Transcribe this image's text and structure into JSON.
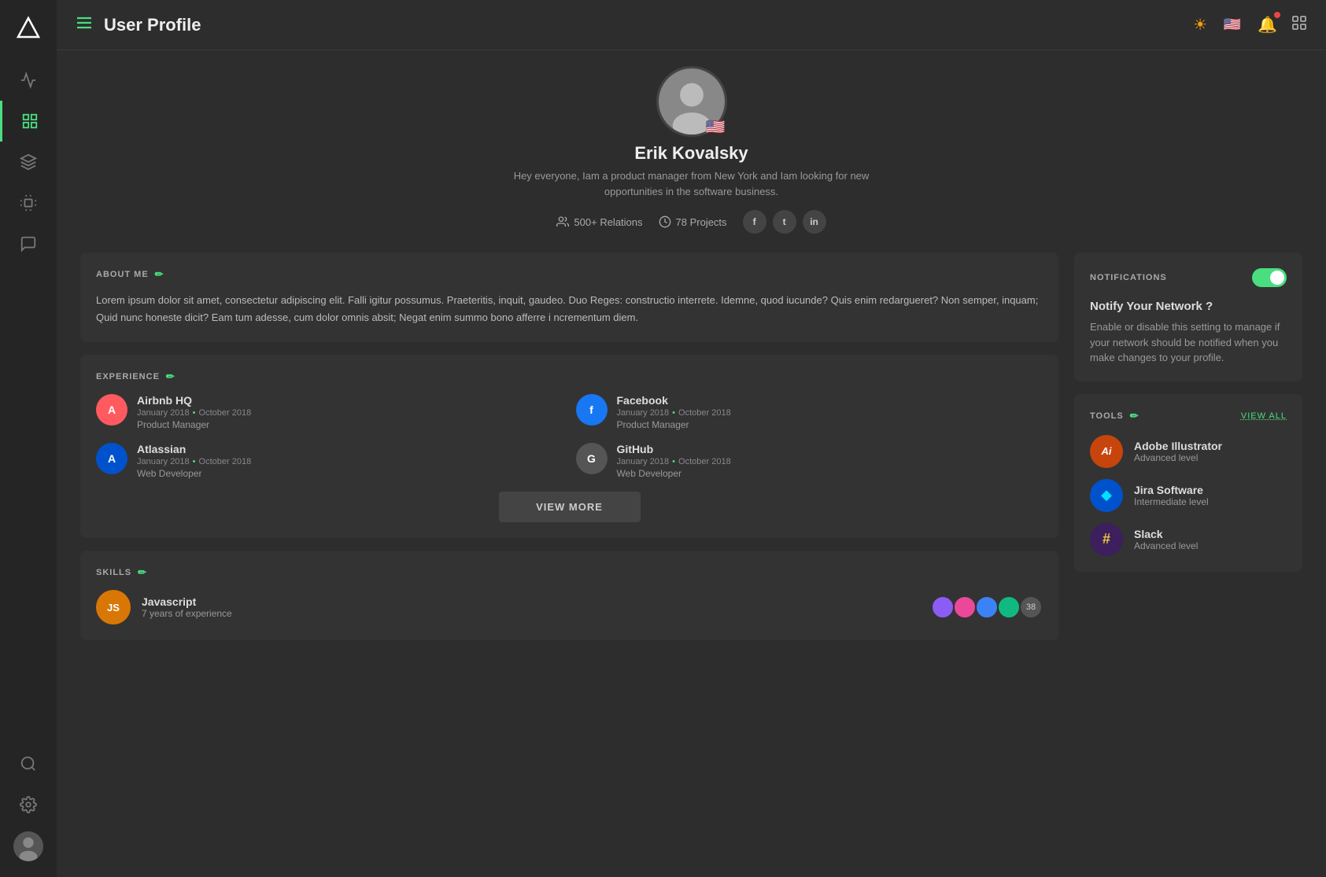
{
  "app": {
    "logo": "triangle",
    "title": "User Profile"
  },
  "sidebar": {
    "items": [
      {
        "id": "activity",
        "icon": "activity"
      },
      {
        "id": "grid",
        "icon": "grid",
        "active": true
      },
      {
        "id": "cube",
        "icon": "cube"
      },
      {
        "id": "chip",
        "icon": "chip"
      },
      {
        "id": "chat",
        "icon": "chat"
      },
      {
        "id": "search",
        "icon": "search"
      },
      {
        "id": "settings",
        "icon": "settings"
      }
    ]
  },
  "header": {
    "title": "User Profile",
    "menu_icon": "☰"
  },
  "profile": {
    "name": "Erik Kovalsky",
    "bio": "Hey everyone,  Iam a product manager from New York and Iam looking for new opportunities in the software business.",
    "flag": "🇺🇸",
    "relations": "500+ Relations",
    "projects": "78 Projects"
  },
  "about": {
    "section_title": "ABOUT ME",
    "text": "Lorem ipsum dolor sit amet, consectetur adipiscing elit. Falli igitur possumus. Praeteritis, inquit, gaudeo. Duo Reges: constructio interrete. Idemne, quod iucunde? Quis enim redargueret? Non semper, inquam; Quid nunc honeste dicit? Eam tum adesse, cum dolor omnis absit; Negat enim summo bono afferre i ncrementum diem."
  },
  "experience": {
    "section_title": "EXPERIENCE",
    "items": [
      {
        "company": "Airbnb HQ",
        "date_start": "January 2018",
        "date_end": "October 2018",
        "role": "Product Manager",
        "logo_text": "A",
        "logo_color": "#ff5a5f"
      },
      {
        "company": "Facebook",
        "date_start": "January 2018",
        "date_end": "October 2018",
        "role": "Product Manager",
        "logo_text": "f",
        "logo_color": "#1877f2"
      },
      {
        "company": "Atlassian",
        "date_start": "January 2018",
        "date_end": "October 2018",
        "role": "Web Developer",
        "logo_text": "A",
        "logo_color": "#0052cc"
      },
      {
        "company": "GitHub",
        "date_start": "January 2018",
        "date_end": "October 2018",
        "role": "Web Developer",
        "logo_text": "G",
        "logo_color": "#555"
      }
    ],
    "view_more_label": "VIEW MORE"
  },
  "skills": {
    "section_title": "SKILLS",
    "items": [
      {
        "name": "Javascript",
        "badge": "JS",
        "badge_color": "#d97706",
        "experience": "7 years of experience",
        "endorser_count": 38
      }
    ]
  },
  "notifications": {
    "section_title": "NOTIFICATIONS",
    "question": "Notify Your Network ?",
    "description": "Enable or disable this setting to manage if your network should be notified when you make changes to your profile.",
    "enabled": true
  },
  "tools": {
    "section_title": "TOOLS",
    "view_all_label": "VIEW ALL",
    "items": [
      {
        "name": "Adobe Illustrator",
        "level": "Advanced level",
        "icon": "Ai",
        "bg_color": "#c7450c"
      },
      {
        "name": "Jira Software",
        "level": "Intermediate level",
        "icon": "Ji",
        "bg_color": "#0052cc"
      },
      {
        "name": "Slack",
        "level": "Advanced level",
        "icon": "Sl",
        "bg_color": "#3c1f5c"
      }
    ]
  }
}
